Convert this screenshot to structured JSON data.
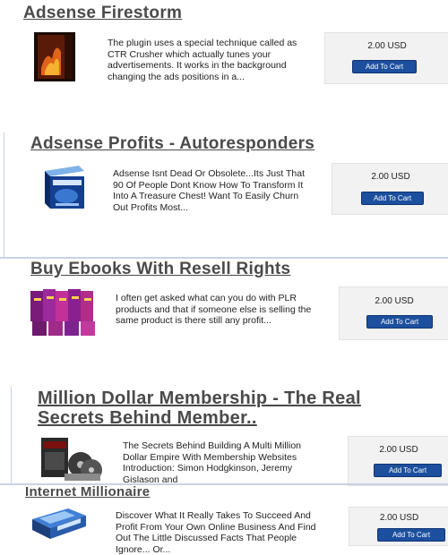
{
  "products": [
    {
      "title": "Adsense Firestorm",
      "description": "The plugin uses a special technique called as CTR Crusher which actually tunes your advertisements. It works in the background changing the ads positions in a...",
      "price": "2.00 USD",
      "button": "Add To Cart"
    },
    {
      "title": "Adsense Profits - Autoresponders",
      "description": "Adsense Isnt Dead Or Obsolete...Its Just That 90 Of People Dont Know How To Transform It Into A Treasure Chest! Want To Easily Churn Out Profits Most...",
      "price": "2.00 USD",
      "button": "Add To Cart"
    },
    {
      "title": "Buy Ebooks With Resell Rights",
      "description": "I often get asked what can you do with PLR products and that if someone else is selling the same product is there still any profit...",
      "price": "2.00 USD",
      "button": "Add To Cart"
    },
    {
      "title_line1": "Million Dollar Membership - The Real",
      "title_line2": "Secrets Behind Member..",
      "description": "The Secrets Behind Building A Multi Million Dollar Empire With Membership Websites Introduction: Simon Hodgkinson, Jeremy Gislason and",
      "price": "2.00 USD",
      "button": "Add To Cart"
    },
    {
      "title": "Internet Millionaire",
      "description": "Discover What It Really Takes To Succeed And Profit From Your Own Online Business And Find Out The Little Discussed Facts That People Ignore... Or...",
      "price": "2.00 USD",
      "button": "Add To Cart"
    }
  ]
}
